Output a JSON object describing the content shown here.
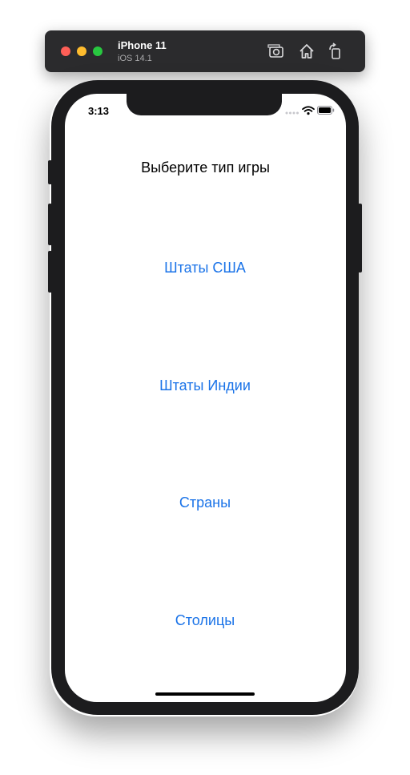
{
  "simulator": {
    "device_name": "iPhone 11",
    "os_version": "iOS 14.1",
    "toolbar_icons": [
      "screenshot-icon",
      "home-icon",
      "rotate-icon"
    ]
  },
  "status_bar": {
    "time": "3:13",
    "icons": [
      "signal-dots-icon",
      "wifi-icon",
      "battery-icon"
    ]
  },
  "screen": {
    "title": "Выберите тип игры",
    "menu": [
      {
        "label": "Штаты США"
      },
      {
        "label": "Штаты Индии"
      },
      {
        "label": "Страны"
      },
      {
        "label": "Столицы"
      }
    ]
  },
  "colors": {
    "accent": "#1a73e8",
    "toolbar_bg": "#2b2b2d",
    "bezel": "#1c1c1e"
  }
}
